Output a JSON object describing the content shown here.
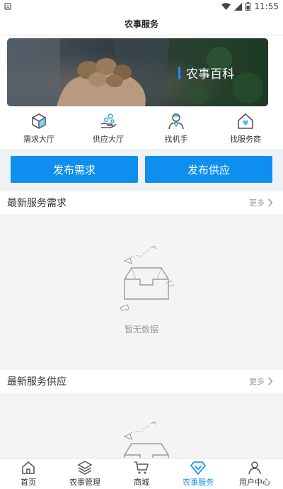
{
  "status_bar": {
    "time": "11:55"
  },
  "header": {
    "title": "农事服务"
  },
  "banner": {
    "text": "农事百科"
  },
  "quick_links": [
    {
      "label": "需求大厅",
      "icon": "cube-icon"
    },
    {
      "label": "供应大厅",
      "icon": "supply-hand-icon"
    },
    {
      "label": "找机手",
      "icon": "operator-person-icon"
    },
    {
      "label": "找服务商",
      "icon": "service-house-icon"
    }
  ],
  "actions": {
    "publish_demand": "发布需求",
    "publish_supply": "发布供应"
  },
  "sections": {
    "demand": {
      "title": "最新服务需求",
      "more": "更多",
      "empty": "暂无数据"
    },
    "supply": {
      "title": "最新服务供应",
      "more": "更多"
    }
  },
  "tabbar": [
    {
      "label": "首页",
      "icon": "home-icon",
      "active": false
    },
    {
      "label": "农事管理",
      "icon": "layers-icon",
      "active": false
    },
    {
      "label": "商城",
      "icon": "cart-icon",
      "active": false
    },
    {
      "label": "农事服务",
      "icon": "service-diamond-icon",
      "active": true
    },
    {
      "label": "用户中心",
      "icon": "user-icon",
      "active": false
    }
  ],
  "colors": {
    "accent": "#0e8ff0",
    "banner_bar": "#1e90ff",
    "page_bg": "#f4f4f4"
  }
}
